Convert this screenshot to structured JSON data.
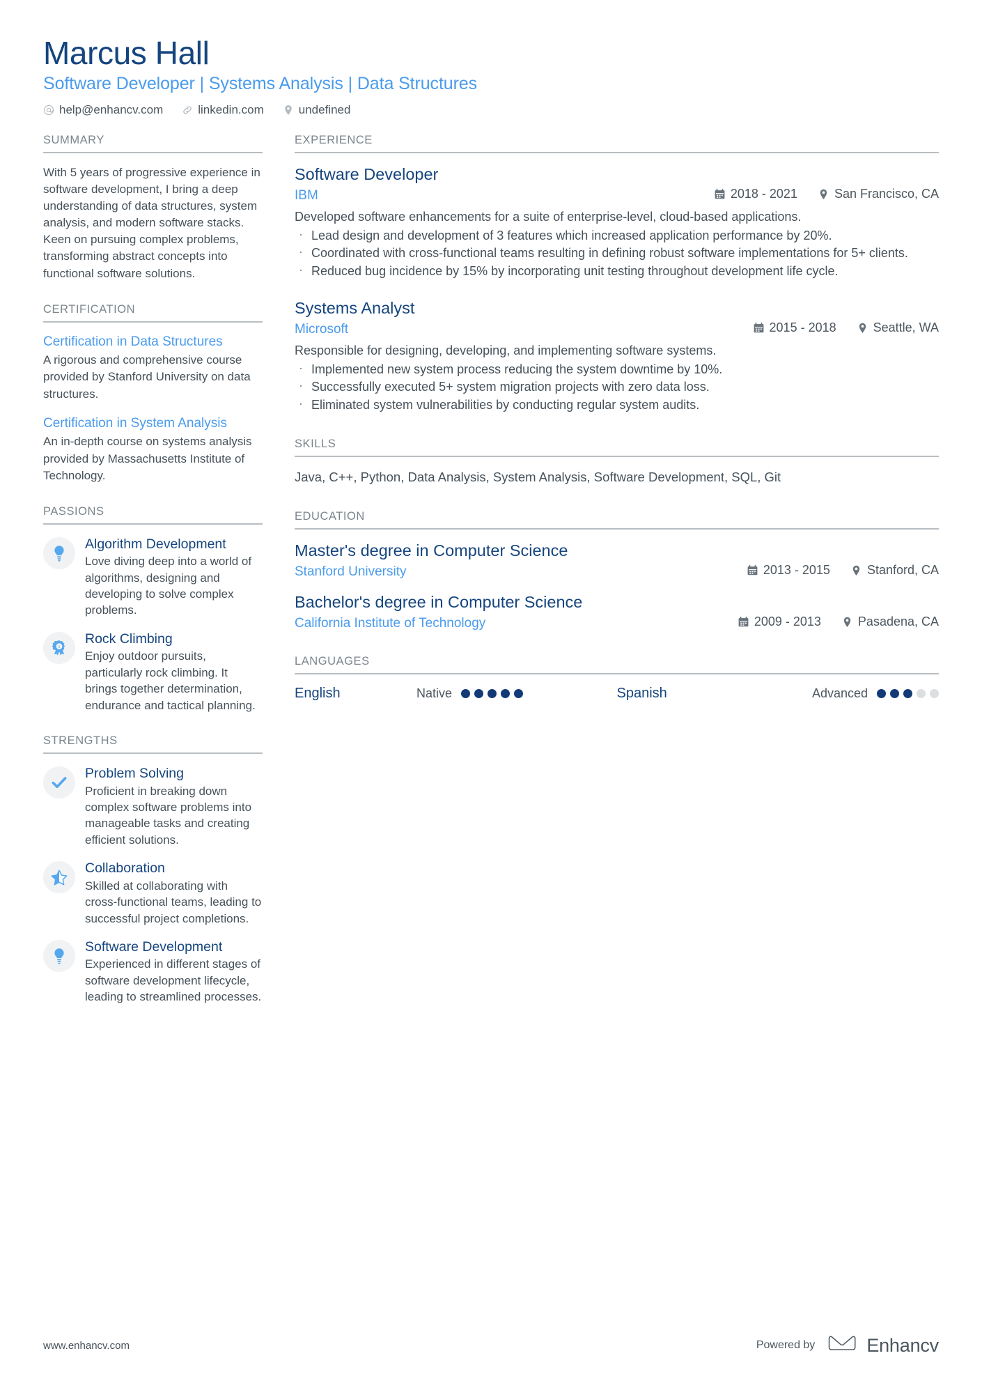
{
  "header": {
    "name": "Marcus Hall",
    "headline": "Software Developer | Systems Analysis | Data Structures",
    "contacts": [
      {
        "icon": "at-icon",
        "text": "help@enhancv.com"
      },
      {
        "icon": "link-icon",
        "text": "linkedin.com"
      },
      {
        "icon": "location-pin-icon",
        "text": "undefined"
      }
    ]
  },
  "sidebar": {
    "summary": {
      "title": "SUMMARY",
      "text": "With 5 years of progressive experience in software development, I bring a deep understanding of data structures, system analysis, and modern software stacks. Keen on pursuing complex problems, transforming abstract concepts into functional software solutions."
    },
    "certification": {
      "title": "CERTIFICATION",
      "items": [
        {
          "title": "Certification in Data Structures",
          "text": "A rigorous and comprehensive course provided by Stanford University on data structures."
        },
        {
          "title": "Certification in System Analysis",
          "text": "An in-depth course on systems analysis provided by Massachusetts Institute of Technology."
        }
      ]
    },
    "passions": {
      "title": "PASSIONS",
      "items": [
        {
          "icon": "lightbulb-icon",
          "title": "Algorithm Development",
          "text": "Love diving deep into a world of algorithms, designing and developing to solve complex problems."
        },
        {
          "icon": "award-ribbon-icon",
          "title": "Rock Climbing",
          "text": "Enjoy outdoor pursuits, particularly rock climbing. It brings together determination, endurance and tactical planning."
        }
      ]
    },
    "strengths": {
      "title": "STRENGTHS",
      "items": [
        {
          "icon": "check-icon",
          "title": "Problem Solving",
          "text": "Proficient in breaking down complex software problems into manageable tasks and creating efficient solutions."
        },
        {
          "icon": "half-star-icon",
          "title": "Collaboration",
          "text": "Skilled at collaborating with cross-functional teams, leading to successful project completions."
        },
        {
          "icon": "lightbulb-icon",
          "title": "Software Development",
          "text": "Experienced in different stages of software development lifecycle, leading to streamlined processes."
        }
      ]
    }
  },
  "main": {
    "experience": {
      "title": "EXPERIENCE",
      "items": [
        {
          "role": "Software Developer",
          "company": "IBM",
          "dates": "2018 - 2021",
          "location": "San Francisco, CA",
          "description": "Developed software enhancements for a suite of enterprise-level, cloud-based applications.",
          "bullets": [
            "Lead design and development of 3 features which increased application performance by 20%.",
            "Coordinated with cross-functional teams resulting in defining robust software implementations for 5+ clients.",
            "Reduced bug incidence by 15% by incorporating unit testing throughout development life cycle."
          ]
        },
        {
          "role": "Systems Analyst",
          "company": "Microsoft",
          "dates": "2015 - 2018",
          "location": "Seattle, WA",
          "description": "Responsible for designing, developing, and implementing software systems.",
          "bullets": [
            "Implemented new system process reducing the system downtime by 10%.",
            "Successfully executed 5+ system migration projects with zero data loss.",
            "Eliminated system vulnerabilities by conducting regular system audits."
          ]
        }
      ]
    },
    "skills": {
      "title": "SKILLS",
      "text": "Java, C++, Python, Data Analysis, System Analysis, Software Development, SQL, Git"
    },
    "education": {
      "title": "EDUCATION",
      "items": [
        {
          "degree": "Master's degree in Computer Science",
          "school": "Stanford University",
          "dates": "2013 - 2015",
          "location": "Stanford, CA"
        },
        {
          "degree": "Bachelor's degree in Computer Science",
          "school": "California Institute of Technology",
          "dates": "2009 - 2013",
          "location": "Pasadena, CA"
        }
      ]
    },
    "languages": {
      "title": "LANGUAGES",
      "items": [
        {
          "name": "English",
          "level": "Native",
          "filled": 5,
          "total": 5
        },
        {
          "name": "Spanish",
          "level": "Advanced",
          "filled": 3,
          "total": 5
        }
      ]
    }
  },
  "footer": {
    "url": "www.enhancv.com",
    "powered_by": "Powered by",
    "brand": "Enhancv"
  },
  "colors": {
    "navy": "#15457e",
    "blue": "#4a9bec",
    "muted": "#7c858c",
    "body": "#46515a",
    "dot_on": "#123a77",
    "dot_off": "#dcdfe1"
  }
}
